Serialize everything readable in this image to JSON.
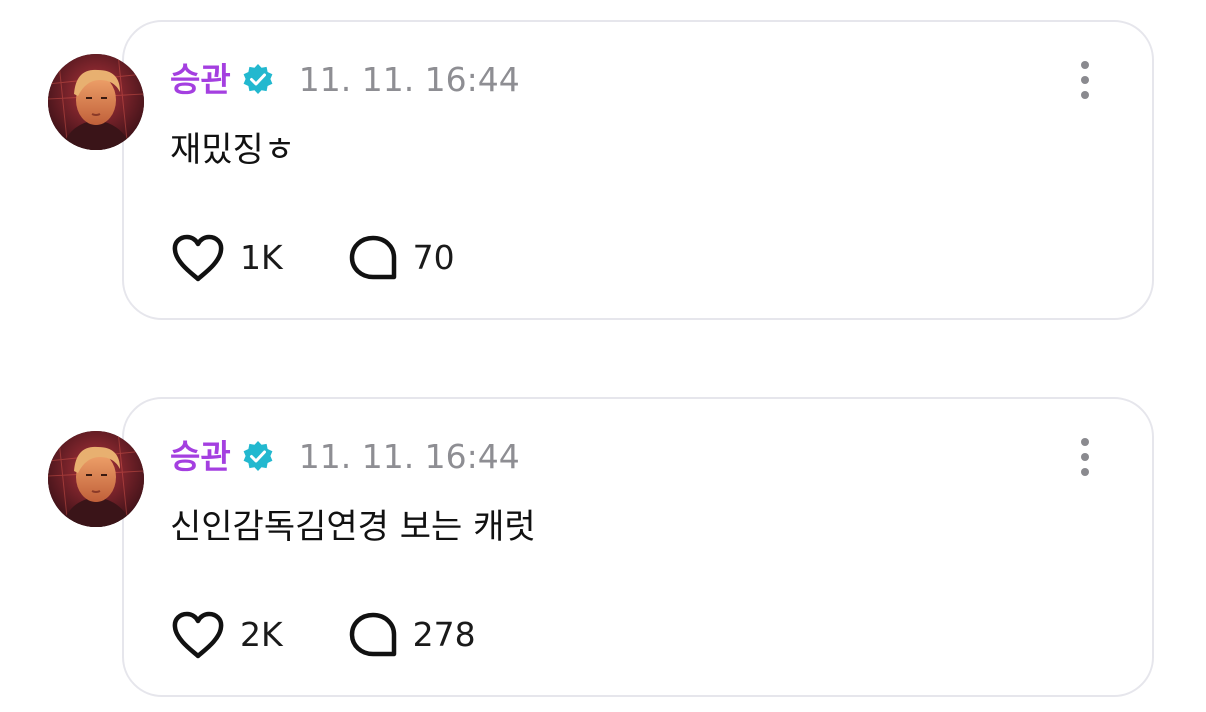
{
  "colors": {
    "username": "#a43fe0",
    "verified_badge": "#22b8cf",
    "timestamp": "#8e8e93",
    "card_border": "#e6e6ec"
  },
  "posts": [
    {
      "author": "승관",
      "verified": true,
      "timestamp": "11. 11. 16:44",
      "text": "재밌징ㅎ",
      "likes": "1K",
      "comments": "70"
    },
    {
      "author": "승관",
      "verified": true,
      "timestamp": "11. 11. 16:44",
      "text": "신인감독김연경 보는 캐럿",
      "likes": "2K",
      "comments": "278"
    }
  ],
  "icons": {
    "like": "heart-icon",
    "comment": "comment-bubble-icon",
    "more": "more-vertical-icon",
    "verified": "verified-badge-icon"
  }
}
